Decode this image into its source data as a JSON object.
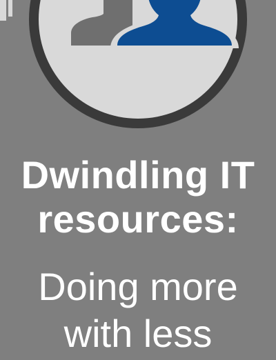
{
  "headline": {
    "line1": "Dwindling IT",
    "line2": "resources:"
  },
  "subhead": {
    "line1": "Doing more",
    "line2": "with less"
  },
  "icons": {
    "emblem": "people-icon",
    "corner": "corner-mark-icon"
  },
  "colors": {
    "background": "#7f7f7f",
    "ring": "#3a3a3a",
    "circle_fill": "#d9d9d9",
    "person_front": "#0d4d92",
    "person_back": "#6f6f6f",
    "text": "#ffffff"
  }
}
